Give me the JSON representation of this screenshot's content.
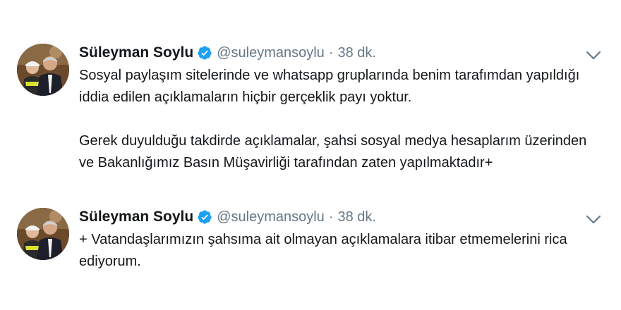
{
  "tweets": [
    {
      "author": {
        "name": "Süleyman Soylu",
        "handle": "@suleymansoylu"
      },
      "separator": "·",
      "time": "38 dk.",
      "paragraphs": [
        {
          "lines": [
            "Sosyal paylaşım sitelerinde ve whatsapp gruplarında benim tarafımdan yapıldığı",
            "iddia edilen açıklamaların hiçbir gerçeklik payı yoktur."
          ]
        },
        {
          "lines": [
            "Gerek duyulduğu takdirde açıklamalar, şahsi sosyal medya hesaplarım üzerinden",
            "ve Bakanlığımız Basın Müşavirliği tarafından zaten yapılmaktadır+"
          ]
        }
      ]
    },
    {
      "author": {
        "name": "Süleyman Soylu",
        "handle": "@suleymansoylu"
      },
      "separator": "·",
      "time": "38 dk.",
      "paragraphs": [
        {
          "lines": [
            "+ Vatandaşlarımızın şahsıma ait olmayan açıklamalara itibar etmemelerini rica",
            "ediyorum."
          ]
        }
      ]
    }
  ],
  "icons": {
    "verified": "verified-badge-icon",
    "caret": "chevron-down-icon"
  },
  "colors": {
    "verified_blue": "#1da1f2",
    "secondary_text": "#657786",
    "primary_text": "#14171a"
  }
}
